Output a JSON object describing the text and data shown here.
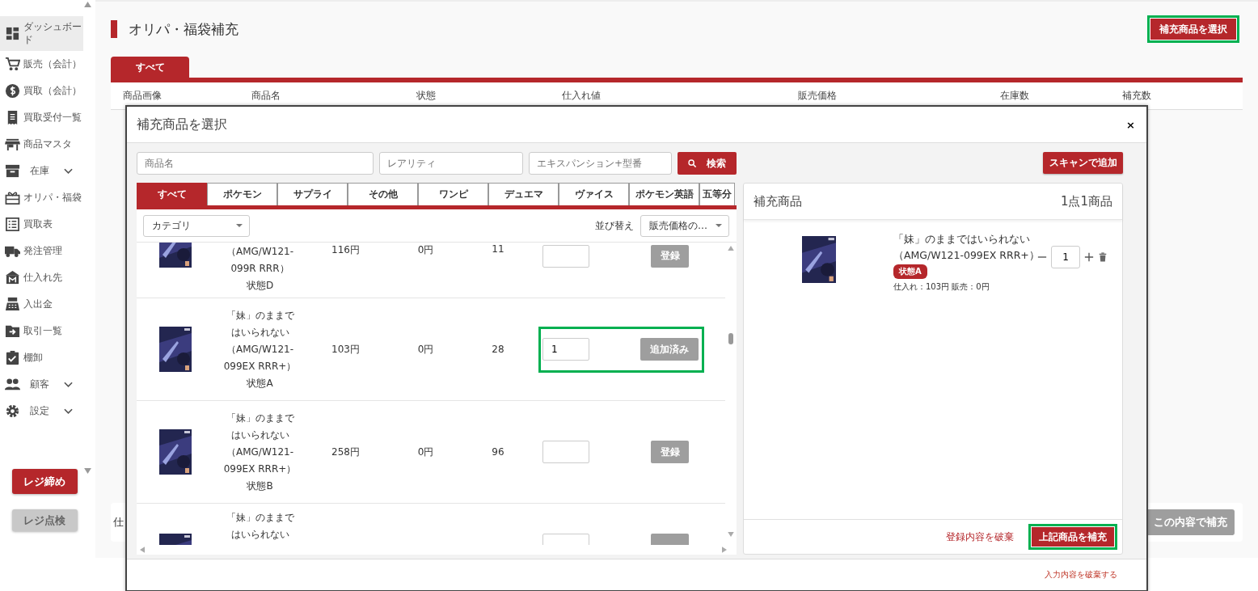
{
  "sidebar": {
    "items": [
      {
        "label": "ダッシュボード",
        "selected": true,
        "expandable": false
      },
      {
        "label": "販売（会計）",
        "selected": false,
        "expandable": false
      },
      {
        "label": "買取（会計）",
        "selected": false,
        "expandable": false
      },
      {
        "label": "買取受付一覧",
        "selected": false,
        "expandable": false
      },
      {
        "label": "商品マスタ",
        "selected": false,
        "expandable": false
      },
      {
        "label": "在庫",
        "selected": false,
        "expandable": true
      },
      {
        "label": "オリパ・福袋",
        "selected": false,
        "expandable": false
      },
      {
        "label": "買取表",
        "selected": false,
        "expandable": false
      },
      {
        "label": "発注管理",
        "selected": false,
        "expandable": false
      },
      {
        "label": "仕入れ先",
        "selected": false,
        "expandable": false
      },
      {
        "label": "入出金",
        "selected": false,
        "expandable": false
      },
      {
        "label": "取引一覧",
        "selected": false,
        "expandable": false
      },
      {
        "label": "棚卸",
        "selected": false,
        "expandable": false
      },
      {
        "label": "顧客",
        "selected": false,
        "expandable": true
      },
      {
        "label": "設定",
        "selected": false,
        "expandable": true
      }
    ],
    "buttons": [
      {
        "label": "レジ締め",
        "kind": "primary"
      },
      {
        "label": "レジ点検",
        "kind": "secondary"
      }
    ]
  },
  "page": {
    "title": "オリパ・福袋補充",
    "action": {
      "label": "補充商品を選択",
      "highlighted": true
    },
    "tabs": [
      {
        "label": "すべて",
        "selected": true
      }
    ],
    "table": {
      "columns": [
        "商品画像",
        "商品名",
        "状態",
        "仕入れ値",
        "販売価格",
        "在庫数",
        "補充数"
      ]
    },
    "footer": {
      "text": "仕",
      "button": "この内容で補充"
    }
  },
  "modal": {
    "title": "補充商品を選択",
    "close": "×",
    "search": {
      "fields": [
        {
          "placeholder": "商品名"
        },
        {
          "placeholder": "レアリティ"
        },
        {
          "placeholder": "エキスパンション+型番"
        }
      ],
      "button": "検索"
    },
    "scan_button": "スキャンで追加",
    "tabs": [
      {
        "label": "すべて",
        "selected": true
      },
      {
        "label": "ポケモン",
        "selected": false
      },
      {
        "label": "サプライ",
        "selected": false
      },
      {
        "label": "その他",
        "selected": false
      },
      {
        "label": "ワンピ",
        "selected": false
      },
      {
        "label": "デュエマ",
        "selected": false
      },
      {
        "label": "ヴァイス",
        "selected": false
      },
      {
        "label": "ポケモン英語",
        "selected": false
      },
      {
        "label": "五等分",
        "selected": false
      }
    ],
    "category": {
      "value": "カテゴリ"
    },
    "sort": {
      "label": "並び替え",
      "value": "販売価格の…"
    },
    "rows": [
      {
        "kind": "cut_top",
        "name": [
          "（AMG/W121-",
          "099R RRR）"
        ],
        "condition": "状態D",
        "cost": "116円",
        "price": "0円",
        "stock": "11",
        "action": {
          "label": "登録",
          "added": false
        },
        "highlighted": false
      },
      {
        "kind": "full",
        "name": [
          "「妹」のままで",
          "はいられない",
          "（AMG/W121-",
          "099EX RRR+）"
        ],
        "condition": "状態A",
        "cost": "103円",
        "price": "0円",
        "stock": "28",
        "quantity": "1",
        "action": {
          "label": "追加済み",
          "added": true
        },
        "highlighted": true
      },
      {
        "kind": "full",
        "name": [
          "「妹」のままで",
          "はいられない",
          "（AMG/W121-",
          "099EX RRR+）"
        ],
        "condition": "状態B",
        "cost": "258円",
        "price": "0円",
        "stock": "96",
        "action": {
          "label": "登録",
          "added": false
        },
        "highlighted": false
      },
      {
        "kind": "cut_bottom",
        "name": [
          "「妹」のままで",
          "はいられない"
        ],
        "highlighted": false
      }
    ],
    "cart": {
      "title": "補充商品",
      "count": "1点1商品",
      "items": [
        {
          "name": [
            "「妹」のままではいられない",
            "（AMG/W121-099EX RRR+）"
          ],
          "condition": "状態A",
          "prices": "仕入れ：103円 販売：0円",
          "quantity": "1"
        }
      ],
      "discard": "登録内容を破棄",
      "submit": {
        "label": "上記商品を補充",
        "highlighted": true
      }
    },
    "footer_link": "入力内容を破棄する"
  }
}
